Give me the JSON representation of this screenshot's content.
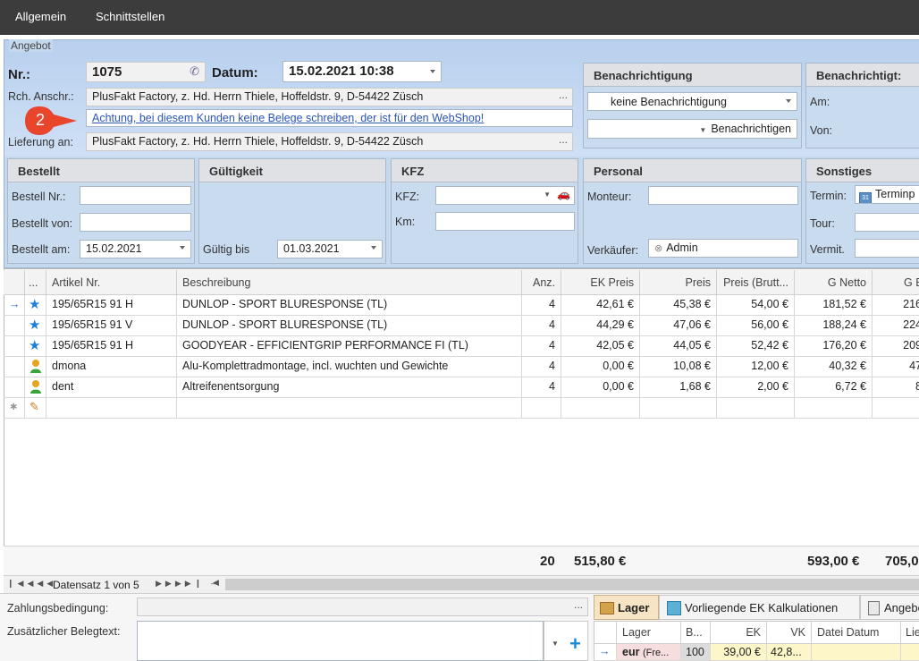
{
  "menu": {
    "items": [
      "Allgemein",
      "Schnittstellen"
    ]
  },
  "angebot": {
    "group_title": "Angebot",
    "nr_label": "Nr.:",
    "nr_value": "1075",
    "datum_label": "Datum:",
    "datum_value": "15.02.2021 10:38",
    "rch_label": "Rch. Anschr.:",
    "rch_value": "PlusFakt Factory, z. Hd. Herrn Thiele, Hoffeldstr. 9,  D-54422 Züsch",
    "warning_link": "Achtung, bei diesem Kunden keine Belege schreiben, der ist für den WebShop!",
    "badge_number": "2",
    "lieferung_label": "Lieferung an:",
    "lieferung_value": "PlusFakt Factory, z. Hd. Herrn Thiele, Hoffeldstr. 9,  D-54422 Züsch",
    "ellipsis": "..."
  },
  "benachrichtigung": {
    "title": "Benachrichtigung",
    "select_value": "keine Benachrichtigung",
    "button_label": "Benachrichtigen"
  },
  "benachrichtigt": {
    "title": "Benachrichtigt:",
    "am_label": "Am:",
    "von_label": "Von:"
  },
  "bestellt": {
    "title": "Bestellt",
    "nr_label": "Bestell Nr.:",
    "von_label": "Bestellt von:",
    "am_label": "Bestellt am:",
    "am_value": "15.02.2021"
  },
  "gueltigkeit": {
    "title": "Gültigkeit",
    "bis_label": "Gültig bis",
    "bis_value": "01.03.2021"
  },
  "kfz": {
    "title": "KFZ",
    "kfz_label": "KFZ:",
    "km_label": "Km:"
  },
  "personal": {
    "title": "Personal",
    "monteur_label": "Monteur:",
    "verkaeufer_label": "Verkäufer:",
    "verkaeufer_value": "Admin"
  },
  "sonstiges": {
    "title": "Sonstiges",
    "termin_label": "Termin:",
    "termin_value": "Terminp",
    "tour_label": "Tour:",
    "vermit_label": "Vermit."
  },
  "grid": {
    "columns": [
      "...",
      "Artikel Nr.",
      "Beschreibung",
      "Anz.",
      "EK Preis",
      "Preis",
      "Preis (Brutt...",
      "G Netto",
      "G B"
    ],
    "rows": [
      {
        "artikel": "195/65R15 91 H",
        "beschreibung": "DUNLOP - SPORT BLURESPONSE (TL)",
        "anz": "4",
        "ek": "42,61 €",
        "preis": "45,38 €",
        "brutto": "54,00 €",
        "gnetto": "181,52 €",
        "gb": "216"
      },
      {
        "artikel": "195/65R15 91 V",
        "beschreibung": "DUNLOP - SPORT BLURESPONSE (TL)",
        "anz": "4",
        "ek": "44,29 €",
        "preis": "47,06 €",
        "brutto": "56,00 €",
        "gnetto": "188,24 €",
        "gb": "224"
      },
      {
        "artikel": "195/65R15 91 H",
        "beschreibung": "GOODYEAR - EFFICIENTGRIP PERFORMANCE FI (TL)",
        "anz": "4",
        "ek": "42,05 €",
        "preis": "44,05 €",
        "brutto": "52,42 €",
        "gnetto": "176,20 €",
        "gb": "209"
      },
      {
        "artikel": "dmona",
        "beschreibung": "Alu-Komplettradmontage, incl. wuchten und Gewichte",
        "anz": "4",
        "ek": "0,00 €",
        "preis": "10,08 €",
        "brutto": "12,00 €",
        "gnetto": "40,32 €",
        "gb": "47"
      },
      {
        "artikel": "dent",
        "beschreibung": "Altreifenentsorgung",
        "anz": "4",
        "ek": "0,00 €",
        "preis": "1,68 €",
        "brutto": "2,00 €",
        "gnetto": "6,72 €",
        "gb": "8"
      }
    ],
    "totals": {
      "anz": "20",
      "ek": "515,80 €",
      "gnetto": "593,00 €",
      "gb": "705,0"
    },
    "nav_text": "Datensatz 1 von 5"
  },
  "bottom": {
    "zahlung_label": "Zahlungsbedingung:",
    "zusatz_label": "Zusätzlicher Belegtext:",
    "tabs": [
      "Lager",
      "Vorliegende EK Kalkulationen",
      "Angebo"
    ],
    "lager_columns": [
      "Lager",
      "B...",
      "EK",
      "VK",
      "Datei Datum",
      "Lie"
    ],
    "lager_row": {
      "lager": "eur",
      "lager_suffix": "(Fre...",
      "b": "100",
      "ek": "39,00 €",
      "vk": "42,8..."
    }
  },
  "colors": {
    "topbar": "#3c3c3c",
    "panel": "#c9dbef",
    "link": "#2a55b8",
    "badge": "#e8452c",
    "star": "#1e7fd8"
  }
}
